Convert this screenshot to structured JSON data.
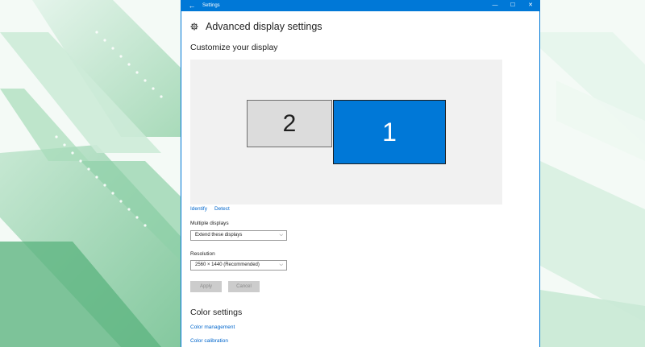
{
  "window": {
    "title": "Settings",
    "back_icon": "back-arrow-icon",
    "controls": {
      "minimize": "—",
      "maximize": "☐",
      "close": "✕"
    }
  },
  "page": {
    "title": "Advanced display settings",
    "icon": "gear-icon"
  },
  "customize": {
    "heading": "Customize your display",
    "displays": [
      {
        "number": "2",
        "selected": false
      },
      {
        "number": "1",
        "selected": true
      }
    ],
    "identify_label": "Identify",
    "detect_label": "Detect"
  },
  "multiple_displays": {
    "label": "Multiple displays",
    "value": "Extend these displays"
  },
  "resolution": {
    "label": "Resolution",
    "value": "2560 × 1440 (Recommended)"
  },
  "buttons": {
    "apply": "Apply",
    "cancel": "Cancel"
  },
  "color": {
    "heading": "Color settings",
    "management": "Color management",
    "calibration": "Color calibration"
  },
  "colors": {
    "accent": "#0078d7",
    "link": "#0066cc",
    "selected_display": "#0078d7",
    "other_display": "#dcdcdc"
  }
}
